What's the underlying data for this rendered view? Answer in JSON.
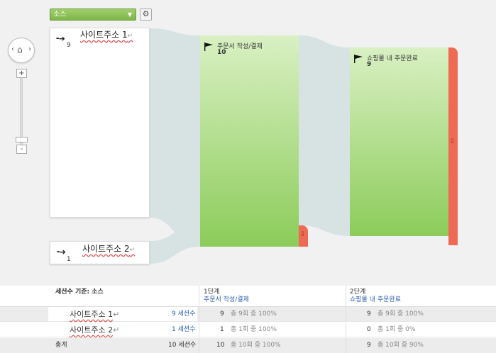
{
  "toolbar": {
    "dimension_label": "소스",
    "caret": "▼",
    "gear": "⚙"
  },
  "nav": {
    "left": "‹",
    "right": "›",
    "home": "⌂",
    "zoom_in": "+",
    "zoom_out": "-"
  },
  "sources": [
    {
      "name": "사이트주소  1",
      "sessions": "9"
    },
    {
      "name": "사이트주소  2",
      "sessions": "1"
    }
  ],
  "return_glyph": "↵",
  "steps": [
    {
      "name": "주문서 작성/결제",
      "value": "10"
    },
    {
      "name": "쇼핑몰 내 주문완료",
      "value": "9"
    }
  ],
  "exit_arrow": "⇩",
  "table": {
    "header": {
      "basis": "세션수 기준: 소스",
      "step1_num": "1단계",
      "step1_name": "주문서 작성/결제",
      "step2_num": "2단계",
      "step2_name": "쇼핑몰 내 주문완료"
    },
    "rows": [
      {
        "name": "사이트주소  1",
        "sessions": "9 세션수",
        "s1_val": "9",
        "s1_note": "총 9회 중 100%",
        "s2_val": "9",
        "s2_note": "총 9회 중 100%"
      },
      {
        "name": "사이트주소  2",
        "sessions": "1 세션수",
        "s1_val": "1",
        "s1_note": "총 1회 중 100%",
        "s2_val": "0",
        "s2_note": "총 1회 중 0%"
      }
    ],
    "total": {
      "label": "총계",
      "sessions": "10 세션수",
      "s1_val": "10",
      "s1_note": "총 10회 중 100%",
      "s2_val": "9",
      "s2_note": "총 10회 중 90%"
    }
  },
  "colors": {
    "step_green_top": "#d9f0c3",
    "step_green_bottom": "#8ccc5a",
    "drop_red": "#ee6a55",
    "flow": "#d7e3e3",
    "selector_green": "#86bd52"
  }
}
